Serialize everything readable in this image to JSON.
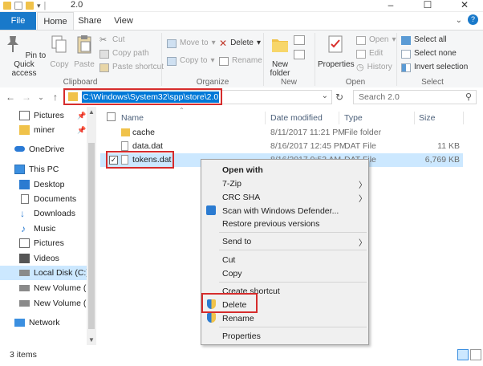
{
  "window": {
    "title": "2.0",
    "controls": {
      "minimize": "–",
      "maximize": "☐",
      "close": "✕"
    }
  },
  "ribbon_tabs": [
    "File",
    "Home",
    "Share",
    "View"
  ],
  "ribbon": {
    "clipboard": {
      "label": "Clipboard",
      "pin": "Pin to Quick access",
      "copy": "Copy",
      "paste": "Paste",
      "cut": "Cut",
      "copy_path": "Copy path",
      "paste_shortcut": "Paste shortcut"
    },
    "organize": {
      "label": "Organize",
      "move_to": "Move to",
      "copy_to": "Copy to",
      "delete": "Delete",
      "rename": "Rename"
    },
    "new": {
      "label": "New",
      "new_folder": "New folder"
    },
    "open": {
      "label": "Open",
      "properties": "Properties",
      "open": "Open",
      "edit": "Edit",
      "history": "History"
    },
    "select": {
      "label": "Select",
      "select_all": "Select all",
      "select_none": "Select none",
      "invert_selection": "Invert selection"
    }
  },
  "address": {
    "path": "C:\\Windows\\System32\\spp\\store\\2.0",
    "search_placeholder": "Search 2.0"
  },
  "nav_pane": {
    "items": [
      {
        "label": "Pictures",
        "icon": "pictures-icon",
        "pinned": true
      },
      {
        "label": "miner",
        "icon": "folder-icon",
        "pinned": true
      },
      {
        "label": "OneDrive",
        "icon": "onedrive-icon"
      },
      {
        "label": "This PC",
        "icon": "pc-icon"
      },
      {
        "label": "Desktop",
        "icon": "desktop-icon"
      },
      {
        "label": "Documents",
        "icon": "documents-icon"
      },
      {
        "label": "Downloads",
        "icon": "downloads-icon"
      },
      {
        "label": "Music",
        "icon": "music-icon"
      },
      {
        "label": "Pictures",
        "icon": "pictures-icon"
      },
      {
        "label": "Videos",
        "icon": "videos-icon"
      },
      {
        "label": "Local Disk (C:)",
        "icon": "drive-icon"
      },
      {
        "label": "New Volume (D:",
        "icon": "drive-icon"
      },
      {
        "label": "New Volume (E:)",
        "icon": "drive-icon"
      },
      {
        "label": "Network",
        "icon": "network-icon"
      }
    ]
  },
  "file_list": {
    "columns": [
      "Name",
      "Date modified",
      "Type",
      "Size"
    ],
    "rows": [
      {
        "name": "cache",
        "date": "8/11/2017 11:21 PM",
        "type": "File folder",
        "size": ""
      },
      {
        "name": "data.dat",
        "date": "8/16/2017 12:45 PM",
        "type": "DAT File",
        "size": "11 KB"
      },
      {
        "name": "tokens.dat",
        "date": "8/16/2017 9:53 AM",
        "type": "DAT File",
        "size": "6,769 KB"
      }
    ]
  },
  "status": {
    "item_count": "3 items"
  },
  "context_menu": {
    "items": [
      "Open with",
      "7-Zip",
      "CRC SHA",
      "Scan with Windows Defender...",
      "Restore previous versions",
      "Send to",
      "Cut",
      "Copy",
      "Create shortcut",
      "Delete",
      "Rename",
      "Properties"
    ]
  },
  "colors": {
    "accent": "#1979ca",
    "selection": "#cce8ff",
    "highlight_box": "#d62c2c",
    "address_selection": "#0078d7"
  }
}
